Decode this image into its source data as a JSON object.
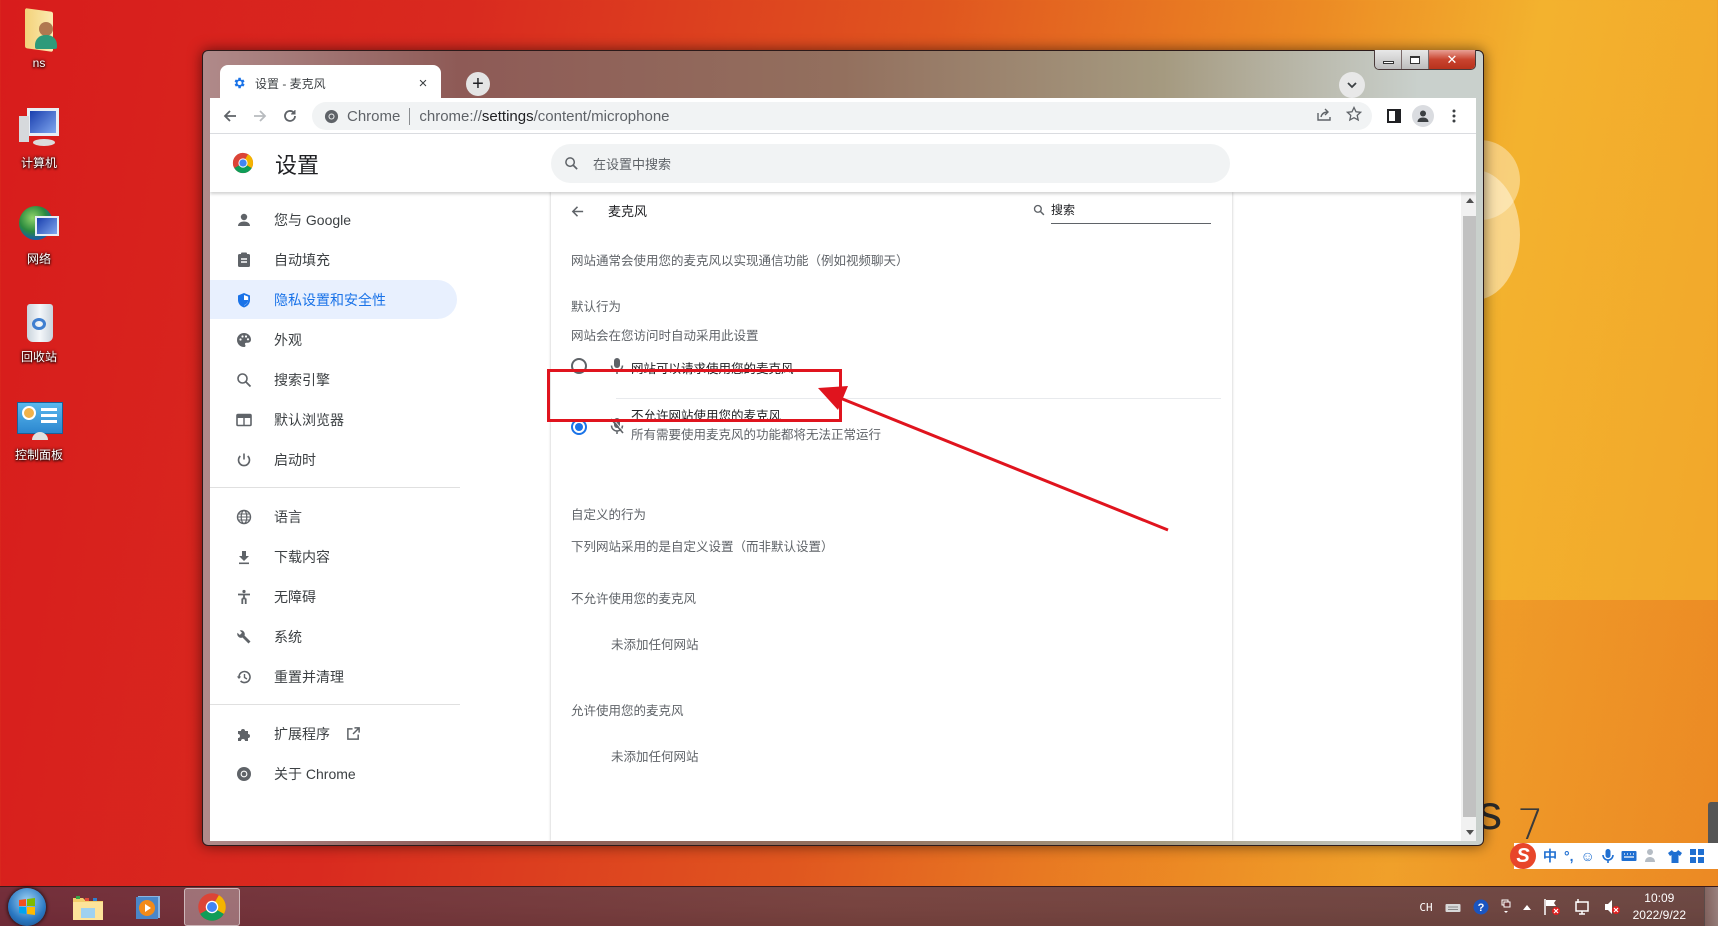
{
  "desktop": {
    "icons": [
      {
        "label": "ns",
        "icon": "user-folder-icon"
      },
      {
        "label": "计算机",
        "icon": "computer-icon"
      },
      {
        "label": "网络",
        "icon": "network-icon"
      },
      {
        "label": "回收站",
        "icon": "recycle-bin-icon"
      },
      {
        "label": "控制面板",
        "icon": "control-panel-icon"
      }
    ],
    "wallpaper_text": "s",
    "wallpaper_number": "7"
  },
  "browser": {
    "tab": {
      "title": "设置 - 麦克风",
      "icon": "gear-icon",
      "close": "×"
    },
    "new_tab": "+",
    "omnibox": {
      "site_label": "Chrome",
      "url_prefix": "chrome://",
      "url_host": "settings",
      "url_path": "/content/microphone"
    }
  },
  "settings": {
    "title": "设置",
    "search_placeholder": "在设置中搜索",
    "sidebar": {
      "groups": [
        [
          {
            "label": "您与 Google",
            "icon": "person-icon",
            "active": false
          },
          {
            "label": "自动填充",
            "icon": "clipboard-icon",
            "active": false
          },
          {
            "label": "隐私设置和安全性",
            "icon": "shield-icon",
            "active": true
          },
          {
            "label": "外观",
            "icon": "palette-icon",
            "active": false
          },
          {
            "label": "搜索引擎",
            "icon": "search-icon",
            "active": false
          },
          {
            "label": "默认浏览器",
            "icon": "browser-window-icon",
            "active": false
          },
          {
            "label": "启动时",
            "icon": "power-icon",
            "active": false
          }
        ],
        [
          {
            "label": "语言",
            "icon": "globe-icon",
            "active": false
          },
          {
            "label": "下载内容",
            "icon": "download-icon",
            "active": false
          },
          {
            "label": "无障碍",
            "icon": "accessibility-icon",
            "active": false
          },
          {
            "label": "系统",
            "icon": "wrench-icon",
            "active": false
          },
          {
            "label": "重置并清理",
            "icon": "history-reset-icon",
            "active": false
          }
        ],
        [
          {
            "label": "扩展程序",
            "icon": "puzzle-icon",
            "active": false,
            "external": true
          },
          {
            "label": "关于 Chrome",
            "icon": "chrome-icon",
            "active": false
          }
        ]
      ]
    },
    "microphone": {
      "page_title": "麦克风",
      "search_placeholder": "搜索",
      "description": "网站通常会使用您的麦克风以实现通信功能（例如视频聊天）",
      "default_behavior_heading": "默认行为",
      "default_behavior_sub": "网站会在您访问时自动采用此设置",
      "options": [
        {
          "label": "网站可以请求使用您的麦克风",
          "sublabel": "",
          "icon": "microphone-icon",
          "selected": false
        },
        {
          "label": "不允许网站使用您的麦克风",
          "sublabel": "所有需要使用麦克风的功能都将无法正常运行",
          "icon": "microphone-off-icon",
          "selected": true
        }
      ],
      "custom_heading": "自定义的行为",
      "custom_sub": "下列网站采用的是自定义设置（而非默认设置）",
      "blocked_heading": "不允许使用您的麦克风",
      "blocked_empty": "未添加任何网站",
      "allowed_heading": "允许使用您的麦克风",
      "allowed_empty": "未添加任何网站"
    }
  },
  "annotation": {
    "color": "#e0141e",
    "target": "网站可以请求使用您的麦克风"
  },
  "ime": {
    "logo": "S",
    "mode": "中",
    "punct": "°,"
  },
  "taskbar": {
    "apps": [
      {
        "name": "explorer",
        "icon": "file-explorer-icon",
        "active": false
      },
      {
        "name": "media-player",
        "icon": "media-player-icon",
        "active": false
      },
      {
        "name": "chrome",
        "icon": "chrome-icon",
        "active": true
      }
    ],
    "tray": {
      "lang": "CH",
      "time": "10:09",
      "date": "2022/9/22"
    }
  },
  "colors": {
    "accent": "#1a73e8",
    "active_nav_bg": "#e8f0fe",
    "annotation": "#e0141e"
  }
}
